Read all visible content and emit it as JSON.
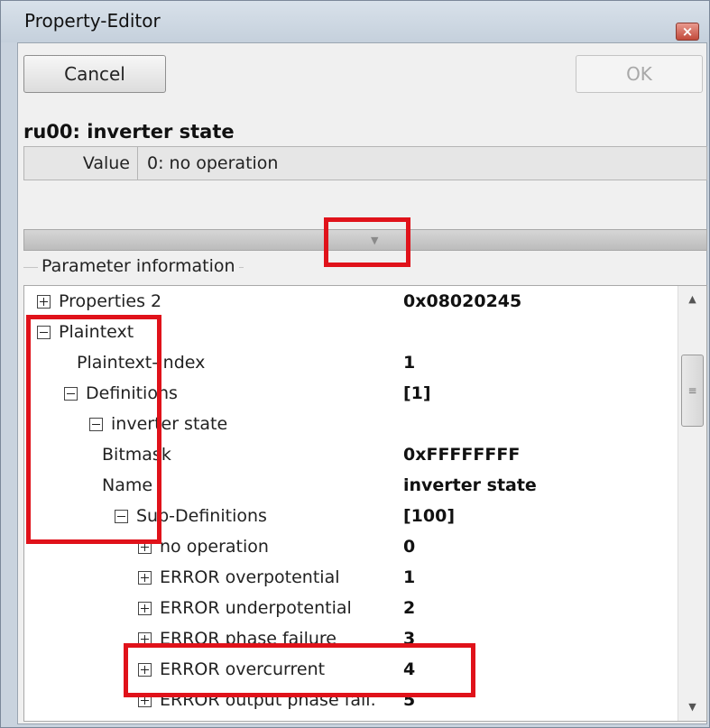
{
  "window": {
    "title": "Property-Editor",
    "close_icon": "close-icon",
    "close_glyph": "×"
  },
  "toolbar": {
    "cancel_label": "Cancel",
    "ok_label": "OK"
  },
  "parameter": {
    "title": "ru00: inverter state",
    "value_label": "Value",
    "value": "0: no operation"
  },
  "splitter": {
    "icon": "chevron-down-icon",
    "glyph": "▼"
  },
  "info": {
    "group_label": "Parameter information",
    "rows": [
      {
        "name": "Properties 2",
        "value": "0x08020245",
        "expander": "plus"
      },
      {
        "name": "Plaintext",
        "value": "",
        "expander": "minus"
      },
      {
        "name": "Plaintext-Index",
        "value": "1",
        "expander": "none"
      },
      {
        "name": "Definitions",
        "value": "[1]",
        "expander": "minus"
      },
      {
        "name": "inverter state",
        "value": "",
        "expander": "minus"
      },
      {
        "name": "Bitmask",
        "value": "0xFFFFFFFF",
        "expander": "none"
      },
      {
        "name": "Name",
        "value": "inverter state",
        "expander": "none"
      },
      {
        "name": "Sub-Definitions",
        "value": "[100]",
        "expander": "minus"
      },
      {
        "name": "no operation",
        "value": "0",
        "expander": "plus"
      },
      {
        "name": "ERROR overpotential",
        "value": "1",
        "expander": "plus"
      },
      {
        "name": "ERROR underpotential",
        "value": "2",
        "expander": "plus"
      },
      {
        "name": "ERROR phase failure",
        "value": "3",
        "expander": "plus"
      },
      {
        "name": "ERROR overcurrent",
        "value": "4",
        "expander": "plus"
      },
      {
        "name": "ERROR output phase fail.",
        "value": "5",
        "expander": "plus"
      }
    ]
  },
  "scrollbar": {
    "up_glyph": "▲",
    "down_glyph": "▼",
    "thumb_glyph": "≡"
  },
  "colors": {
    "highlight": "#e0121a",
    "titlebar": "#c9d3de"
  }
}
